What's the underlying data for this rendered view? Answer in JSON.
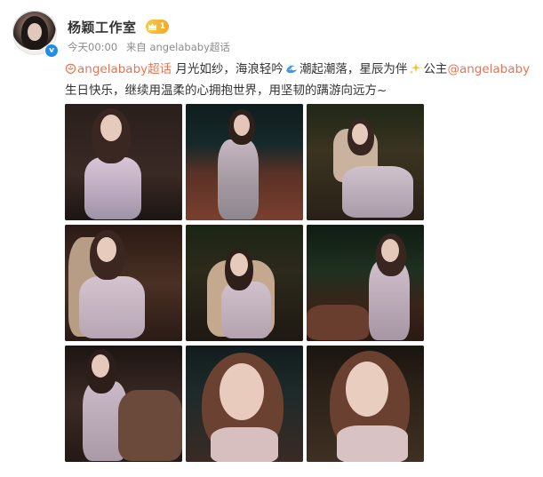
{
  "post": {
    "author": "杨颖工作室",
    "level": "1",
    "time": "今天00:00",
    "source": "来自 angelababy超话",
    "text": {
      "topic": "angelababy超话",
      "part1": " 月光如纱，海浪轻吟",
      "part2": "潮起潮落，星辰为伴",
      "part3": "公主",
      "mention": "@angelababy",
      "part4": "生日快乐，继续用温柔的心拥抱世界，用坚韧的蹒游向远方~"
    }
  },
  "icons": {
    "verified": "verified-badge-icon",
    "level": "crown-level-icon",
    "topic": "super-topic-icon",
    "wave": "wave-emoji-icon",
    "sparkle": "sparkles-emoji-icon"
  },
  "colors": {
    "link": "#eb7350",
    "text": "#333333",
    "meta": "#8b8b8b",
    "verified": "#1f8ee9",
    "level": "#f0a92a"
  },
  "photos": [
    {
      "desc": "photo-1"
    },
    {
      "desc": "photo-2"
    },
    {
      "desc": "photo-3"
    },
    {
      "desc": "photo-4"
    },
    {
      "desc": "photo-5"
    },
    {
      "desc": "photo-6"
    },
    {
      "desc": "photo-7"
    },
    {
      "desc": "photo-8"
    },
    {
      "desc": "photo-9"
    }
  ]
}
